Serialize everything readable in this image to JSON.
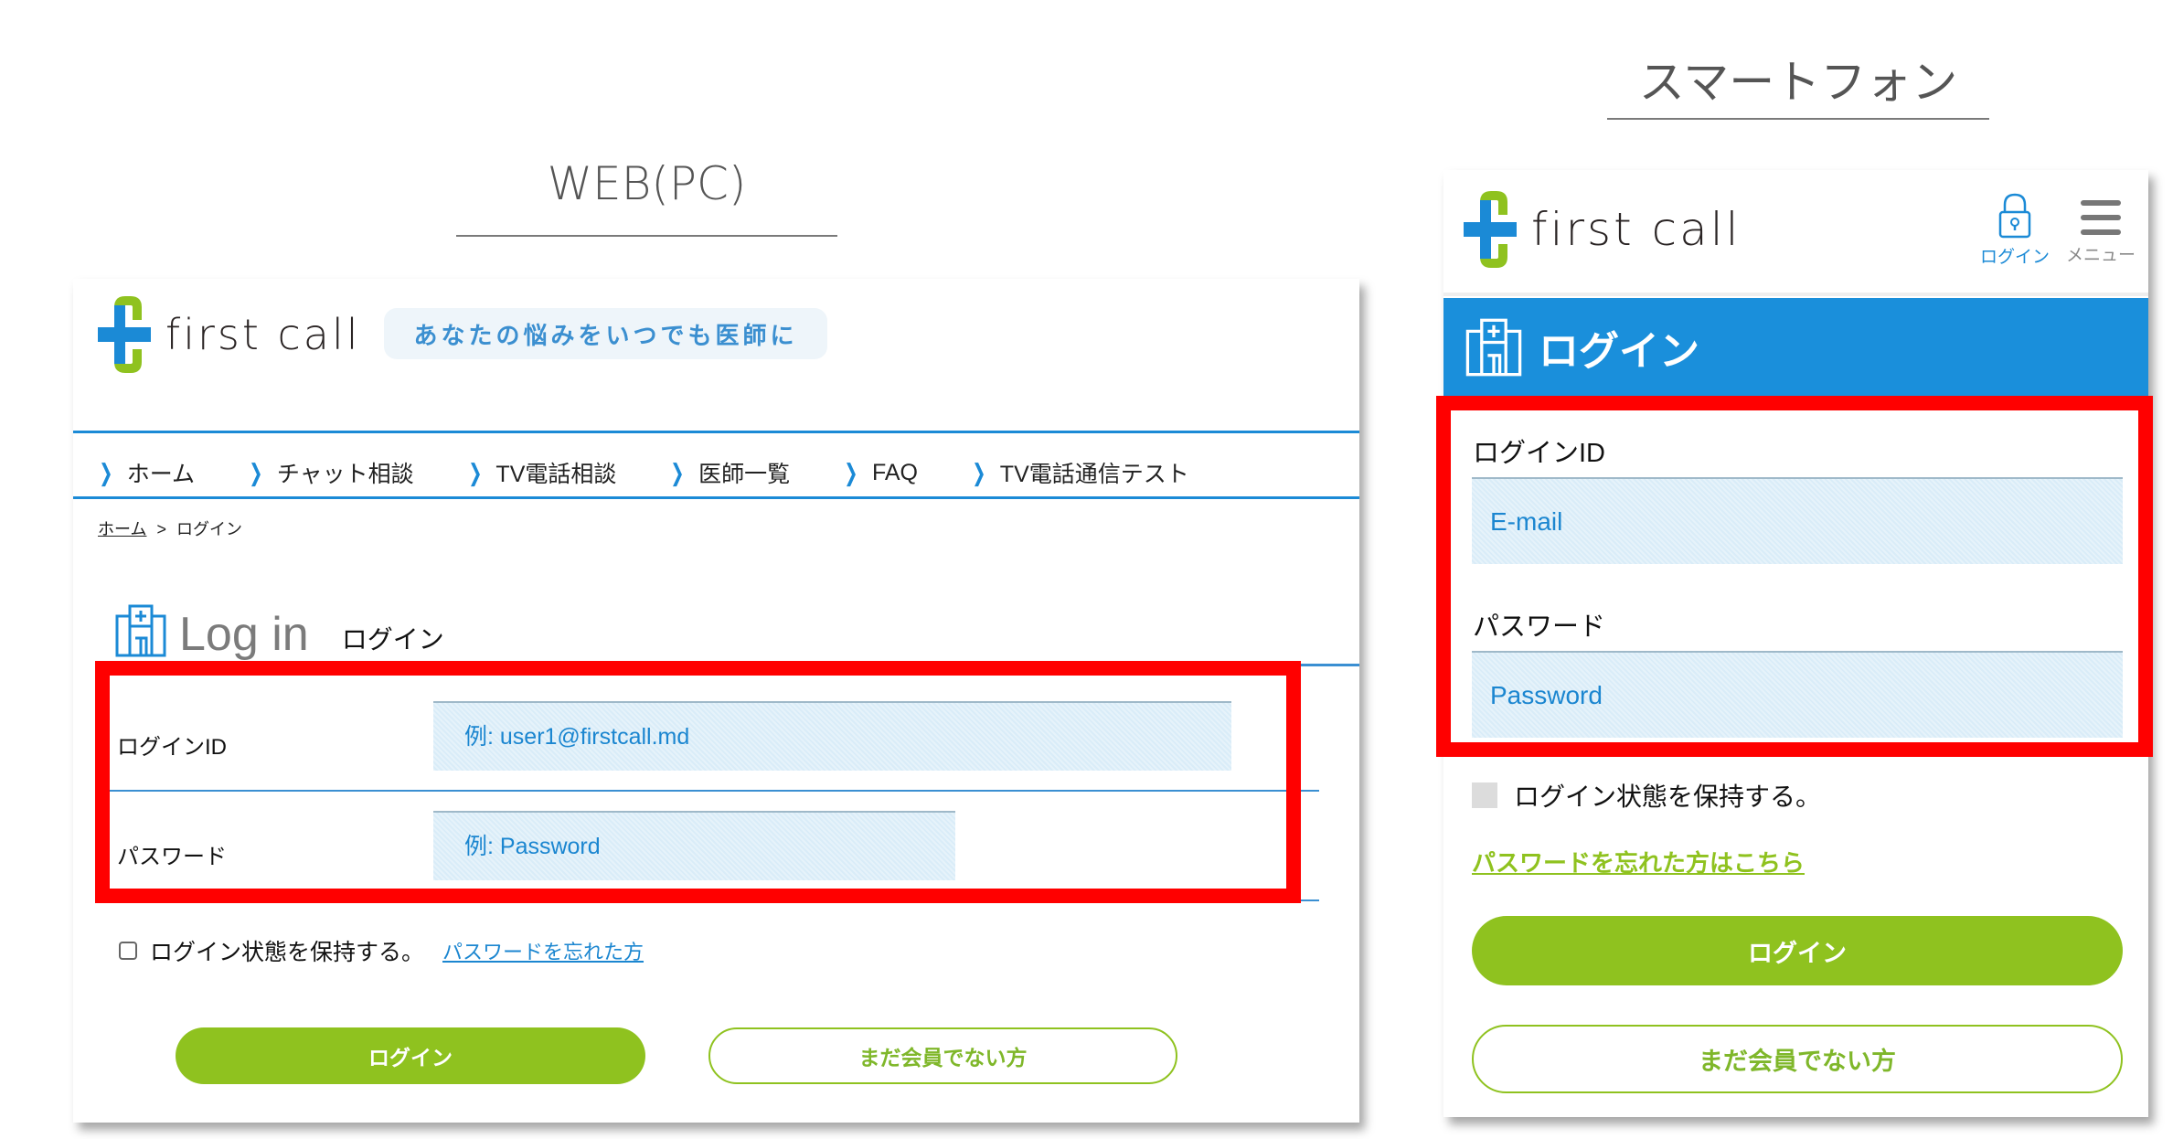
{
  "sections": {
    "pc_title": "WEB(PC)",
    "sp_title": "スマートフォン"
  },
  "brand": {
    "name": "first call",
    "tagline": "あなたの悩みをいつでも医師に",
    "colors": {
      "blue": "#1b8ad6",
      "green": "#8fc21f",
      "highlight_red": "#ff0000",
      "input_bg": "#d9ecf8"
    }
  },
  "pc": {
    "nav": [
      {
        "label": "ホーム",
        "icon": "chevron-right-icon"
      },
      {
        "label": "チャット相談",
        "icon": "chevron-right-icon"
      },
      {
        "label": "TV電話相談",
        "icon": "chevron-right-icon"
      },
      {
        "label": "医師一覧",
        "icon": "chevron-right-icon"
      },
      {
        "label": "FAQ",
        "icon": "chevron-right-icon"
      },
      {
        "label": "TV電話通信テスト",
        "icon": "chevron-right-icon"
      }
    ],
    "breadcrumb": {
      "home": "ホーム",
      "separator": ">",
      "current": "ログイン"
    },
    "heading": {
      "icon": "hospital-icon",
      "en": "Log in",
      "ja": "ログイン"
    },
    "form": {
      "login_id_label": "ログインID",
      "login_id_placeholder": "例: user1@firstcall.md",
      "password_label": "パスワード",
      "password_placeholder": "例: Password",
      "remember_label": "ログイン状態を保持する。",
      "remember_checked": false,
      "forgot_link": "パスワードを忘れた方"
    },
    "buttons": {
      "login": "ログイン",
      "register": "まだ会員でない方"
    }
  },
  "sp": {
    "header": {
      "login_icon": "lock-icon",
      "login_label": "ログイン",
      "menu_icon": "hamburger-menu-icon",
      "menu_label": "メニュー"
    },
    "banner": {
      "icon": "hospital-icon",
      "title": "ログイン"
    },
    "form": {
      "login_id_label": "ログインID",
      "login_id_placeholder": "E-mail",
      "password_label": "パスワード",
      "password_placeholder": "Password",
      "remember_label": "ログイン状態を保持する。",
      "remember_checked": false,
      "forgot_link": "パスワードを忘れた方はこちら"
    },
    "buttons": {
      "login": "ログイン",
      "register": "まだ会員でない方"
    }
  }
}
